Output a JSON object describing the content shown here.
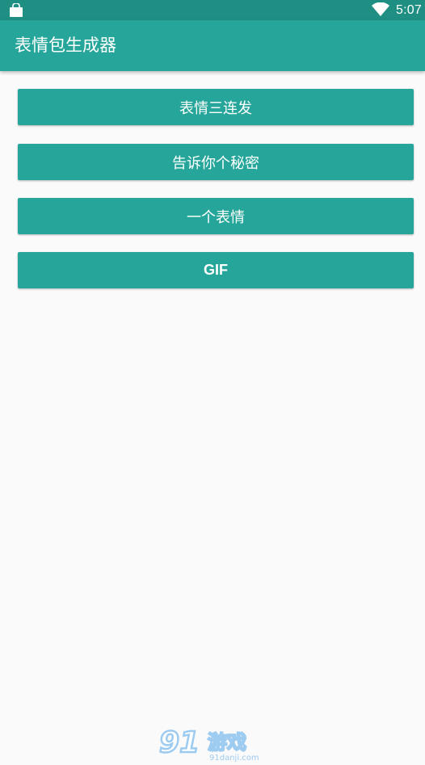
{
  "status_bar": {
    "time": "5:07",
    "left_icon": "shopping-bag-icon",
    "right_icon": "wifi-icon"
  },
  "app_bar": {
    "title": "表情包生成器"
  },
  "buttons": [
    {
      "label": "表情三连发"
    },
    {
      "label": "告诉你个秘密"
    },
    {
      "label": "一个表情"
    },
    {
      "label": "GIF"
    }
  ],
  "watermark": {
    "text": "91游戏",
    "subtext": "91danji.com"
  },
  "colors": {
    "primary": "#26a69a",
    "primary_dark": "#1f8f83",
    "background": "#fafafa"
  }
}
